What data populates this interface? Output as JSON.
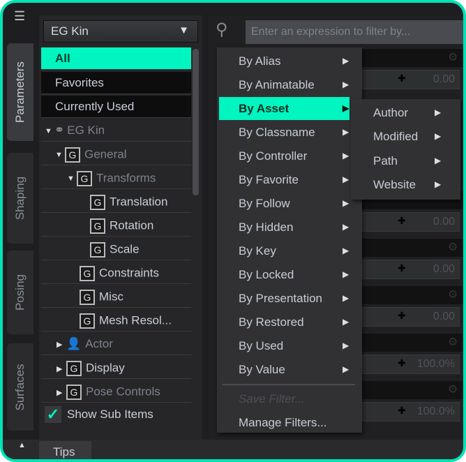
{
  "accent": "#00f5c0",
  "side_tabs": [
    "Parameters",
    "Shaping",
    "Posing",
    "Surfaces"
  ],
  "node_selector": {
    "value": "EG Kin"
  },
  "categories": [
    "All",
    "Favorites",
    "Currently Used"
  ],
  "tree": [
    {
      "label": "EG Kin",
      "icon": "figure-icon",
      "expand": "down"
    },
    {
      "label": "General",
      "icon": "group-icon",
      "expand": "down"
    },
    {
      "label": "Transforms",
      "icon": "group-icon",
      "expand": "down"
    },
    {
      "label": "Translation",
      "icon": "group-icon"
    },
    {
      "label": "Rotation",
      "icon": "group-icon"
    },
    {
      "label": "Scale",
      "icon": "group-icon"
    },
    {
      "label": "Constraints",
      "icon": "group-icon"
    },
    {
      "label": "Misc",
      "icon": "group-icon"
    },
    {
      "label": "Mesh Resol...",
      "icon": "group-icon"
    },
    {
      "label": "Actor",
      "icon": "actor-icon",
      "expand": "right"
    },
    {
      "label": "Display",
      "icon": "group-icon",
      "expand": "right"
    },
    {
      "label": "Pose Controls",
      "icon": "group-icon",
      "expand": "right"
    }
  ],
  "group_icon_letter": "G",
  "show_sub_items": {
    "label": "Show Sub Items",
    "checked": true
  },
  "search": {
    "placeholder": "Enter an expression to filter by..."
  },
  "param_values": [
    "0.00",
    "0.00",
    "0.00",
    "0.00",
    "100.0%",
    "100.0%"
  ],
  "filter_menu": {
    "items": [
      "By Alias",
      "By Animatable",
      "By Asset",
      "By Classname",
      "By Controller",
      "By Favorite",
      "By Follow",
      "By Hidden",
      "By Key",
      "By Locked",
      "By Presentation",
      "By Restored",
      "By Used",
      "By Value"
    ],
    "highlighted": "By Asset",
    "save_filter": "Save Filter...",
    "manage_filters": "Manage Filters..."
  },
  "asset_submenu": [
    "Author",
    "Modified",
    "Path",
    "Website"
  ],
  "bottom_tab": "Tips"
}
